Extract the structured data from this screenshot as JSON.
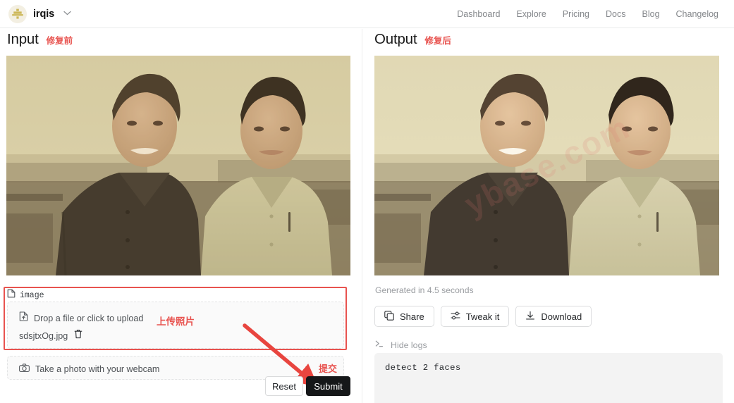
{
  "nav": {
    "brand": "irqis",
    "brand_caret": "⌄",
    "logo_icon": "irqis-logo-icon",
    "links": [
      {
        "label": "Dashboard"
      },
      {
        "label": "Explore"
      },
      {
        "label": "Pricing"
      },
      {
        "label": "Docs"
      },
      {
        "label": "Blog"
      },
      {
        "label": "Changelog"
      }
    ]
  },
  "input_panel": {
    "title": "Input",
    "annotation": "修复前",
    "image_alt": "old sepia photograph of two men standing outdoors",
    "upload": {
      "field_label": "image",
      "file_icon": "file-image-icon",
      "drop_text": "Drop a file or click to upload",
      "drop_icon": "file-upload-icon",
      "file_name": "sdsjtxOg.jpg",
      "delete_icon": "trash-icon",
      "annotation": "上传照片"
    },
    "webcam": {
      "icon": "camera-icon",
      "label": "Take a photo with your webcam"
    },
    "buttons": {
      "reset": "Reset",
      "submit": "Submit",
      "submit_annotation": "提交"
    }
  },
  "output_panel": {
    "title": "Output",
    "annotation": "修复后",
    "image_alt": "restored color photograph of the same two men",
    "watermark": "ybase.com",
    "generated_text": "Generated in 4.5 seconds",
    "actions": [
      {
        "label": "Share",
        "icon": "copy-icon"
      },
      {
        "label": "Tweak it",
        "icon": "sliders-icon"
      },
      {
        "label": "Download",
        "icon": "download-icon"
      }
    ],
    "logs": {
      "toggle_icon": "terminal-prompt-icon",
      "toggle_label": "Hide logs",
      "content": "detect 2 faces"
    }
  },
  "colors": {
    "accent_red": "#e8534f",
    "brand_gold": "#cdb85a",
    "submit_bg": "#151719"
  }
}
